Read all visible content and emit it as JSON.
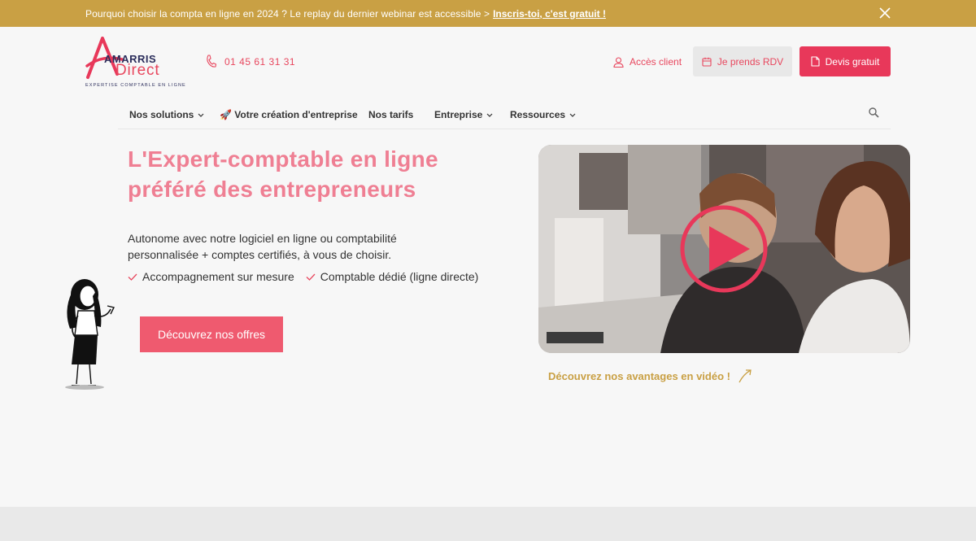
{
  "banner": {
    "text": "Pourquoi choisir la compta en ligne en 2024 ? Le replay du dernier webinar est accessible >",
    "link": "Inscris-toi, c'est gratuit !"
  },
  "logo": {
    "brand_line1": "AMARRIS",
    "brand_line2": "Direct",
    "tagline": "EXPERTISE COMPTABLE EN LIGNE"
  },
  "header": {
    "phone": "01 45 61 31 31",
    "client_access": "Accès client",
    "rdv_button": "Je prends RDV",
    "quote_button": "Devis gratuit"
  },
  "nav": {
    "items": [
      {
        "label": "Nos solutions",
        "dropdown": true
      },
      {
        "label": "🚀 Votre création d'entreprise",
        "dropdown": false
      },
      {
        "label": "Nos tarifs",
        "dropdown": false
      },
      {
        "label": "Entreprise",
        "dropdown": true
      },
      {
        "label": "Ressources",
        "dropdown": true
      }
    ]
  },
  "hero": {
    "title_line1": "L'Expert-comptable en ligne",
    "title_line2": "préféré des entrepreneurs",
    "description": "Autonome avec notre logiciel en ligne ou comptabilité personnalisée + comptes certifiés, à vous de choisir.",
    "checks": [
      "Accompagnement sur mesure",
      "Comptable dédié (ligne directe)"
    ],
    "cta": "Découvrez nos offres"
  },
  "video": {
    "link_text": "Découvrez nos avantages en vidéo !"
  },
  "colors": {
    "accent": "#e8385a",
    "gold": "#c9a044",
    "title_pink": "#ef7f93",
    "navy": "#2b2d5b"
  }
}
